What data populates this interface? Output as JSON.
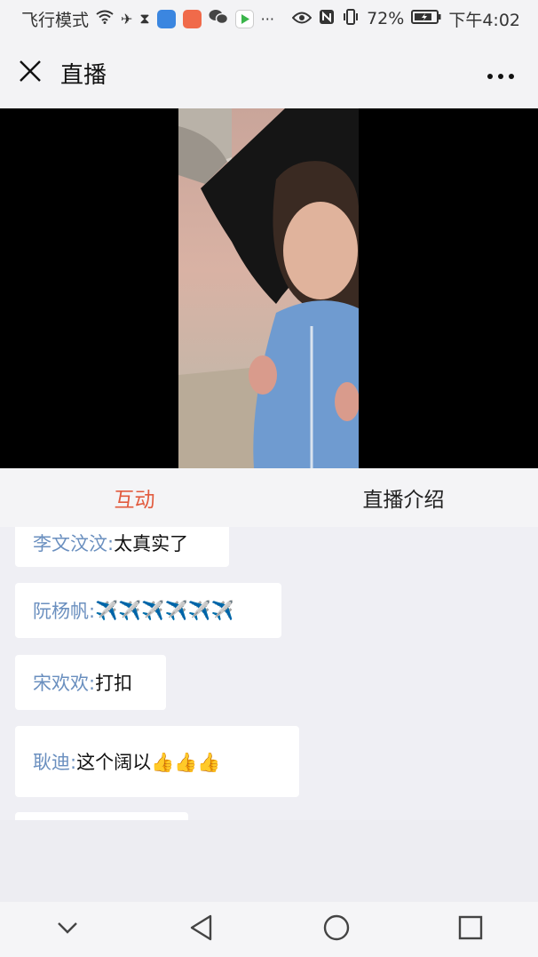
{
  "status_bar": {
    "left_text": "飞行模式",
    "battery": "72%",
    "time": "下午4:02",
    "icons": [
      "wifi-icon",
      "airplane-icon",
      "hourglass-icon",
      "shield-app-icon",
      "app-icon",
      "wechat-icon",
      "play-app-icon",
      "more-dots-icon",
      "eye-icon",
      "nfc-icon",
      "vibrate-icon",
      "battery-icon"
    ]
  },
  "header": {
    "title": "直播",
    "close_icon": "close-icon",
    "more_icon": "more-icon"
  },
  "tabs": [
    {
      "label": "互动",
      "active": true
    },
    {
      "label": "直播介绍",
      "active": false
    }
  ],
  "chat": {
    "messages": [
      {
        "user": "李文汶汶:",
        "text": "太真实了"
      },
      {
        "user": "阮杨帆:",
        "text": "✈️✈️✈️✈️✈️✈️"
      },
      {
        "user": "宋欢欢:",
        "text": "打扣"
      },
      {
        "user": "耿迪:",
        "text": "这个阔以👍👍👍"
      }
    ]
  },
  "nav": [
    "chevron-down-icon",
    "back-icon",
    "home-icon",
    "recents-icon"
  ],
  "colors": {
    "accent": "#e25b3e",
    "username": "#6a8fbf",
    "background": "#efeff4"
  }
}
